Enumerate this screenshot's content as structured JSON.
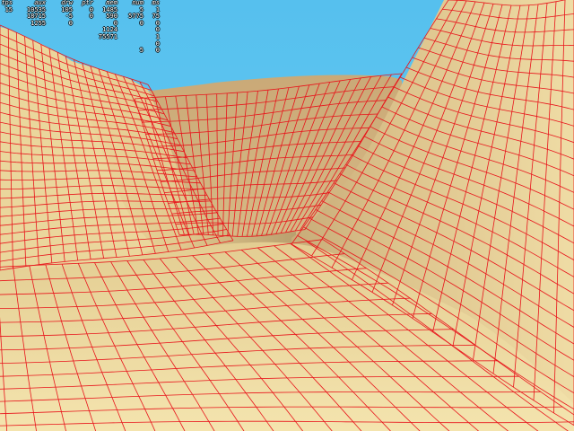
{
  "colors": {
    "sky": "#5cc4f0",
    "sand_light": "#ecd9a0",
    "sand_mid": "#dcc083",
    "sand_dark": "#b49a6b",
    "wire": "#e8141b"
  },
  "scene": {
    "type": "terrain-wireframe-view"
  },
  "hud": {
    "columns": [
      "fps",
      "aux",
      "drw",
      "ptr",
      "mem",
      "num",
      "ms"
    ],
    "rows": [
      [
        "15",
        "10535",
        "105",
        "0",
        "1485",
        "5",
        "1"
      ],
      [
        "",
        "18715",
        "-5",
        "0",
        "590",
        "5775",
        "75"
      ],
      [
        "",
        "1255",
        "0",
        "",
        "0",
        "0",
        "0"
      ],
      [
        "",
        "",
        "",
        "",
        "1124",
        "",
        "0"
      ],
      [
        "",
        "",
        "",
        "",
        "75571",
        "",
        "1"
      ],
      [
        "",
        "",
        "",
        "",
        "",
        "",
        "0"
      ],
      [
        "",
        "",
        "",
        "",
        "",
        "5",
        "0"
      ]
    ]
  }
}
